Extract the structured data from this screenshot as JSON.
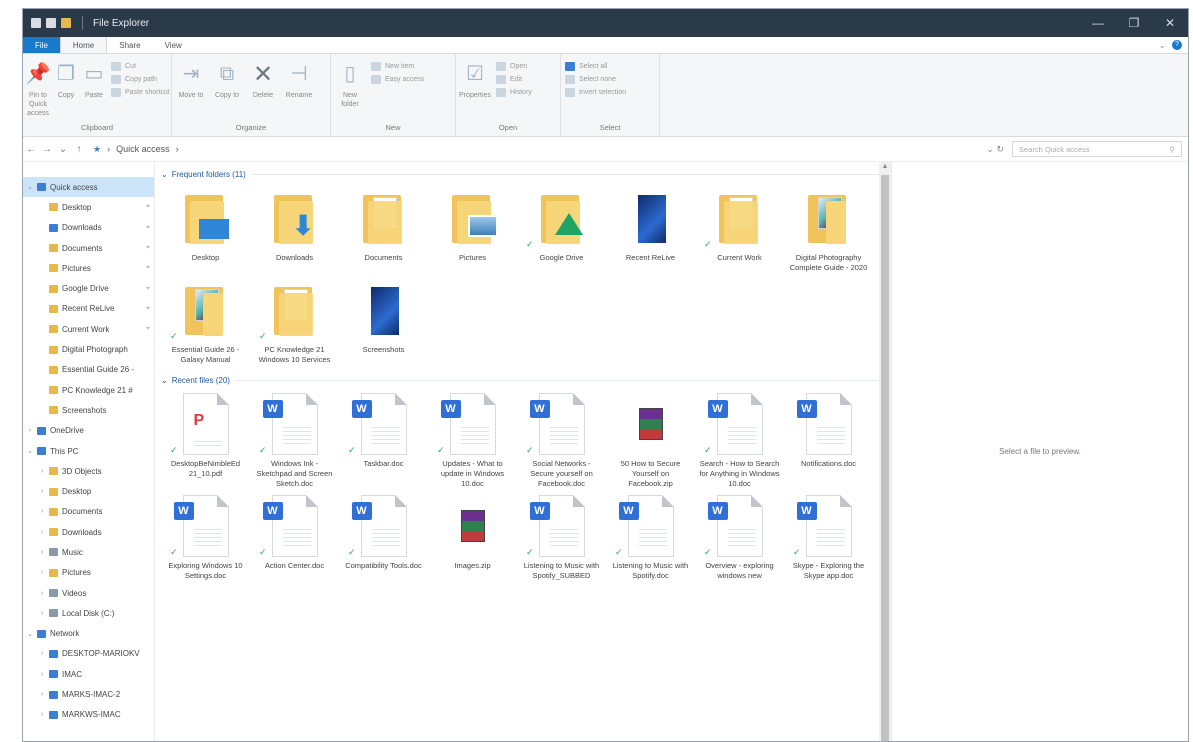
{
  "window": {
    "title": "File Explorer",
    "controls": [
      "—",
      "❐",
      "✕"
    ]
  },
  "tabs": [
    {
      "label": "File"
    },
    {
      "label": "Home"
    },
    {
      "label": "Share"
    },
    {
      "label": "View"
    }
  ],
  "ribbon": {
    "clipboard": {
      "pin_label": "Pin to Quick access",
      "copy_label": "Copy",
      "paste_label": "Paste",
      "cut_label": "Cut",
      "copy_path_label": "Copy path",
      "paste_shortcut_label": "Paste shortcut",
      "group_label": "Clipboard"
    },
    "organize": {
      "move_label": "Move to",
      "copy_to_label": "Copy to",
      "delete_label": "Delete",
      "rename_label": "Rename",
      "group_label": "Organize"
    },
    "new": {
      "new_folder_label": "New folder",
      "new_item_label": "New item",
      "easy_access_label": "Easy access",
      "group_label": "New"
    },
    "open": {
      "properties_label": "Properties",
      "open_label": "Open",
      "edit_label": "Edit",
      "history_label": "History",
      "group_label": "Open"
    },
    "select": {
      "select_all_label": "Select all",
      "select_none_label": "Select none",
      "invert_label": "Invert selection",
      "group_label": "Select"
    }
  },
  "address": {
    "crumb": "Quick access",
    "search_placeholder": "Search Quick access"
  },
  "nav": [
    {
      "label": "Quick access",
      "icon": "star-icon",
      "level": 0,
      "selected": true,
      "chevron": "v"
    },
    {
      "label": "Desktop",
      "icon": "folder-icon",
      "level": 1,
      "pinned": true
    },
    {
      "label": "Downloads",
      "icon": "download-icon",
      "level": 1,
      "pinned": true
    },
    {
      "label": "Documents",
      "icon": "folder-icon",
      "level": 1,
      "pinned": true
    },
    {
      "label": "Pictures",
      "icon": "folder-icon",
      "level": 1,
      "pinned": true
    },
    {
      "label": "Google Drive",
      "icon": "folder-icon",
      "level": 1,
      "pinned": true
    },
    {
      "label": "Recent ReLive",
      "icon": "folder-icon",
      "level": 1,
      "pinned": true
    },
    {
      "label": "Current Work",
      "icon": "folder-icon",
      "level": 1,
      "pinned": true
    },
    {
      "label": "Digital Photograph",
      "icon": "folder-icon",
      "level": 1
    },
    {
      "label": "Essential Guide 26 -",
      "icon": "folder-icon",
      "level": 1
    },
    {
      "label": "PC Knowledge 21 #",
      "icon": "folder-icon",
      "level": 1
    },
    {
      "label": "Screenshots",
      "icon": "folder-icon",
      "level": 1
    },
    {
      "label": "OneDrive",
      "icon": "cloud-icon",
      "level": 0,
      "chevron": ">"
    },
    {
      "label": "This PC",
      "icon": "computer-icon",
      "level": 0,
      "chevron": "v"
    },
    {
      "label": "3D Objects",
      "icon": "folder-icon",
      "level": 1,
      "chevron": ">"
    },
    {
      "label": "Desktop",
      "icon": "folder-icon",
      "level": 1,
      "chevron": ">"
    },
    {
      "label": "Documents",
      "icon": "folder-icon",
      "level": 1,
      "chevron": ">"
    },
    {
      "label": "Downloads",
      "icon": "folder-icon",
      "level": 1,
      "chevron": ">"
    },
    {
      "label": "Music",
      "icon": "music-icon",
      "level": 1,
      "chevron": ">"
    },
    {
      "label": "Pictures",
      "icon": "folder-icon",
      "level": 1,
      "chevron": ">"
    },
    {
      "label": "Videos",
      "icon": "video-icon",
      "level": 1,
      "chevron": ">"
    },
    {
      "label": "Local Disk (C:)",
      "icon": "drive-icon",
      "level": 1,
      "chevron": ">"
    },
    {
      "label": "Network",
      "icon": "network-icon",
      "level": 0,
      "chevron": "v"
    },
    {
      "label": "DESKTOP-MARIOKV",
      "icon": "computer-icon",
      "level": 1,
      "chevron": ">"
    },
    {
      "label": "IMAC",
      "icon": "computer-icon",
      "level": 1,
      "chevron": ">"
    },
    {
      "label": "MARKS-IMAC-2",
      "icon": "computer-icon",
      "level": 1,
      "chevron": ">"
    },
    {
      "label": "MARKWS-IMAC",
      "icon": "computer-icon",
      "level": 1,
      "chevron": ">"
    }
  ],
  "frequent": {
    "header": "Frequent folders (11)",
    "items": [
      {
        "label": "Desktop",
        "kind": "folder-desktop",
        "synced": false
      },
      {
        "label": "Downloads",
        "kind": "folder-download",
        "synced": false
      },
      {
        "label": "Documents",
        "kind": "folder-docs",
        "synced": false
      },
      {
        "label": "Pictures",
        "kind": "folder-pictures",
        "synced": false
      },
      {
        "label": "Google Drive",
        "kind": "folder-gdrive",
        "synced": true
      },
      {
        "label": "Recent ReLive",
        "kind": "folder-dark",
        "synced": false
      },
      {
        "label": "Current Work",
        "kind": "folder-docs",
        "synced": true
      },
      {
        "label": "Digital Photography Complete Guide - 2020",
        "kind": "folder-photo",
        "synced": false
      },
      {
        "label": "Essential Guide 26 - Galaxy Manual",
        "kind": "folder-photo",
        "synced": true
      },
      {
        "label": "PC Knowledge 21 Windows 10 Services",
        "kind": "folder-docs",
        "synced": true
      },
      {
        "label": "Screenshots",
        "kind": "folder-dark",
        "synced": false
      }
    ]
  },
  "recent": {
    "header": "Recent files (20)",
    "items": [
      {
        "label": "DesktopBeNimbleEd 21_10.pdf",
        "kind": "pdf",
        "synced": true
      },
      {
        "label": "Windows Ink - Sketchpad and Screen Sketch.doc",
        "kind": "word",
        "synced": true
      },
      {
        "label": "Taskbar.doc",
        "kind": "word",
        "synced": true
      },
      {
        "label": "Updates - What to update in Windows 10.doc",
        "kind": "word",
        "synced": true
      },
      {
        "label": "Social Networks - Secure yourself on Facebook.doc",
        "kind": "word",
        "synced": true
      },
      {
        "label": "50 How to Secure Yourself on Facebook.zip",
        "kind": "rar",
        "synced": false
      },
      {
        "label": "Search - How to Search for Anything in Windows 10.doc",
        "kind": "word",
        "synced": true
      },
      {
        "label": "Notifications.doc",
        "kind": "word",
        "synced": false
      },
      {
        "label": "Exploring Windows 10 Settings.doc",
        "kind": "word",
        "synced": true
      },
      {
        "label": "Action Center.doc",
        "kind": "word",
        "synced": true
      },
      {
        "label": "Compatibility Tools.doc",
        "kind": "word",
        "synced": true
      },
      {
        "label": "Images.zip",
        "kind": "rar",
        "synced": false
      },
      {
        "label": "Listening to Music with Spotify_SUBBED",
        "kind": "word",
        "synced": true
      },
      {
        "label": "Listening to Music with Spotify.doc",
        "kind": "word",
        "synced": true
      },
      {
        "label": "Overview - exploring windows new",
        "kind": "word",
        "synced": true
      },
      {
        "label": "Skype - Exploring the Skype app.doc",
        "kind": "word",
        "synced": true
      }
    ]
  },
  "preview": {
    "text": "Select a file to preview."
  },
  "colors": {
    "accent": "#1979ca",
    "titlebar": "#2b3a48",
    "folder": "#f0c35b",
    "word_badge": "#2f6fd6",
    "sync_check": "#2fa84f"
  }
}
